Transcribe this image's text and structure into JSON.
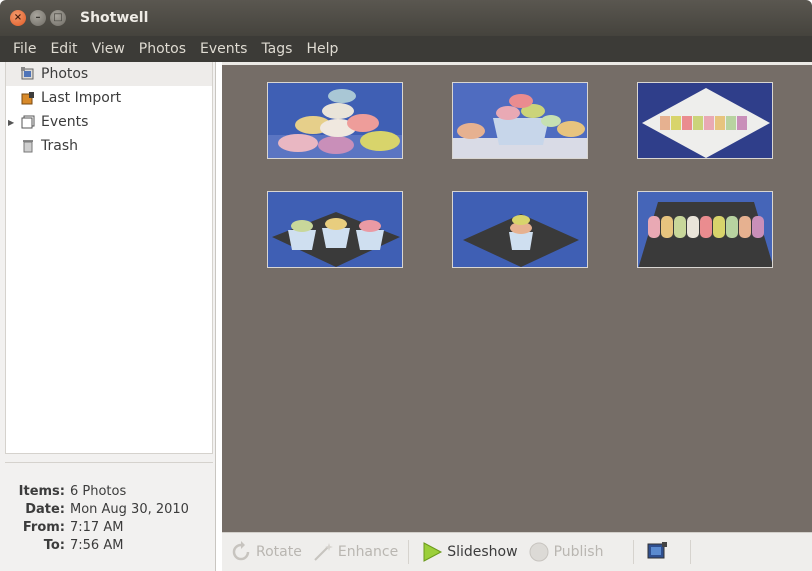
{
  "window": {
    "title": "Shotwell",
    "close_glyph": "×",
    "min_glyph": "–",
    "max_glyph": "□"
  },
  "menu": [
    "File",
    "Edit",
    "View",
    "Photos",
    "Events",
    "Tags",
    "Help"
  ],
  "sidebar": {
    "items": [
      {
        "label": "Photos",
        "icon": "photos-icon"
      },
      {
        "label": "Last Import",
        "icon": "last-import-icon"
      },
      {
        "label": "Events",
        "icon": "events-icon"
      },
      {
        "label": "Trash",
        "icon": "trash-icon"
      }
    ]
  },
  "info": {
    "items_label": "Items:",
    "items_value": "6 Photos",
    "date_label": "Date:",
    "date_value": "Mon Aug 30, 2010",
    "from_label": "From:",
    "from_value": "7:17 AM",
    "to_label": "To:",
    "to_value": "7:56 AM"
  },
  "toolbar": {
    "rotate": "Rotate",
    "enhance": "Enhance",
    "slideshow": "Slideshow",
    "publish": "Publish"
  },
  "colors": {
    "grid_background": "#756d67",
    "accent_orange": "#e05a25",
    "slideshow_green": "#9bcf3a"
  },
  "photos": [
    {
      "name": "macaron-stack"
    },
    {
      "name": "macaron-bowl-tablecloth"
    },
    {
      "name": "macaron-row-plate"
    },
    {
      "name": "three-macaron-cups"
    },
    {
      "name": "single-macaron-cup"
    },
    {
      "name": "macaron-row-dark-plate"
    }
  ]
}
